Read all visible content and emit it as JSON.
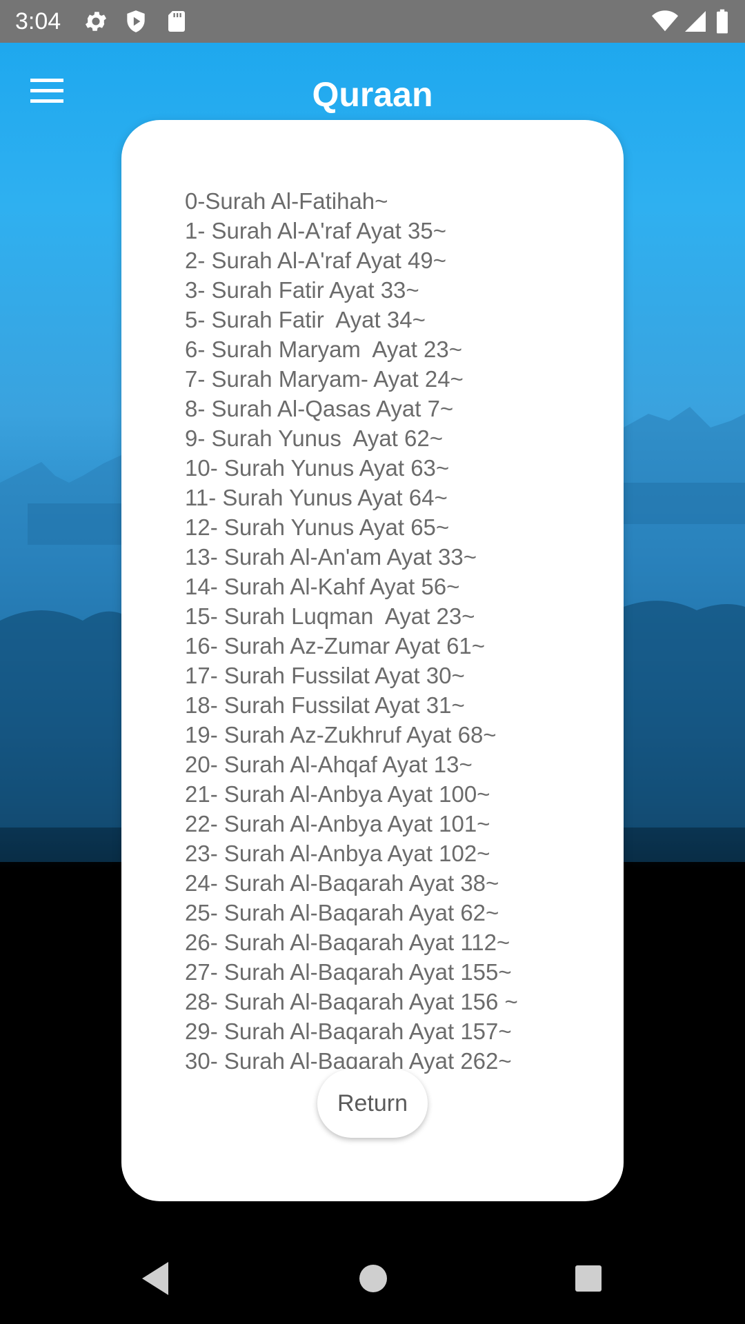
{
  "status_bar": {
    "time": "3:04",
    "left_icons": [
      "gear-icon",
      "shield-play-icon",
      "sd-card-icon"
    ],
    "right_icons": [
      "wifi-icon",
      "signal-icon",
      "battery-icon"
    ],
    "background": "#757575"
  },
  "app_bar": {
    "title": "Quraan",
    "menu_icon": "hamburger-menu-icon"
  },
  "card": {
    "verses": [
      "0-Surah Al-Fatihah~",
      "1- Surah Al-A'raf Ayat 35~",
      "2- Surah Al-A'raf Ayat 49~",
      "3- Surah Fatir Ayat 33~",
      "5- Surah Fatir  Ayat 34~",
      "6- Surah Maryam  Ayat 23~",
      "7- Surah Maryam- Ayat 24~",
      "8- Surah Al-Qasas Ayat 7~",
      "9- Surah Yunus  Ayat 62~",
      "10- Surah Yunus Ayat 63~",
      "11- Surah Yunus Ayat 64~",
      "12- Surah Yunus Ayat 65~",
      "13- Surah Al-An'am Ayat 33~",
      "14- Surah Al-Kahf Ayat 56~",
      "15- Surah Luqman  Ayat 23~",
      "16- Surah Az-Zumar Ayat 61~",
      "17- Surah Fussilat Ayat 30~",
      "18- Surah Fussilat Ayat 31~",
      "19- Surah Az-Zukhruf Ayat 68~",
      "20- Surah Al-Ahqaf Ayat 13~",
      "21- Surah Al-Anbya Ayat 100~",
      "22- Surah Al-Anbya Ayat 101~",
      "23- Surah Al-Anbya Ayat 102~",
      "24- Surah Al-Baqarah Ayat 38~",
      "25- Surah Al-Baqarah Ayat 62~",
      "26- Surah Al-Baqarah Ayat 112~",
      "27- Surah Al-Baqarah Ayat 155~",
      "28- Surah Al-Baqarah Ayat 156 ~",
      "29- Surah Al-Baqarah Ayat 157~",
      "30- Surah Al-Baqarah Ayat 262~"
    ],
    "return_label": "Return"
  },
  "nav_bar": {
    "icons": [
      "back-triangle-icon",
      "home-circle-icon",
      "recents-square-icon"
    ]
  },
  "colors": {
    "sky_top": "#1aa6ee",
    "text_gray": "#6b6b6b",
    "card_bg": "#ffffff"
  }
}
